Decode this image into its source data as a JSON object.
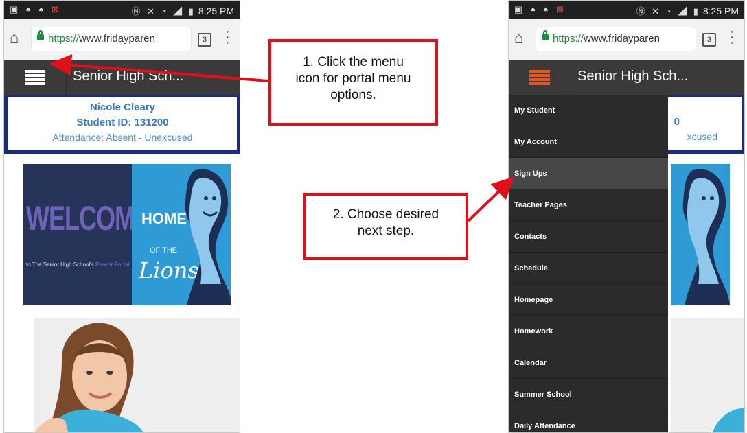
{
  "status_bar": {
    "time": "8:25 PM"
  },
  "browser": {
    "url_scheme": "https://",
    "url_rest": "www.fridayparen",
    "tab_count": "3"
  },
  "app": {
    "title_left": "Senior High Sch...",
    "title_right": "Senior High Sch..."
  },
  "student": {
    "name": "Nicole Cleary",
    "id_text": "Student ID: 131200",
    "attendance": "Attendance: Absent - Unexcused",
    "attendance_partial": "xcused",
    "id_partial": "0"
  },
  "banner": {
    "welcome": "WELCOME",
    "sub_text": "to The Senior High School's",
    "sub_highlight": "Parent Portal",
    "home": "HOME",
    "of_the": "OF THE",
    "lions": "Lions"
  },
  "menu": {
    "items": [
      {
        "label": "My Student"
      },
      {
        "label": "My Account"
      },
      {
        "label": "Sign Ups"
      },
      {
        "label": "Teacher Pages"
      },
      {
        "label": "Contacts"
      },
      {
        "label": "Schedule"
      },
      {
        "label": "Homepage"
      },
      {
        "label": "Homework"
      },
      {
        "label": "Calendar"
      },
      {
        "label": "Summer School"
      },
      {
        "label": "Daily Attendance"
      }
    ],
    "selected_index": 2
  },
  "callouts": {
    "step1": "1. Click the menu icon for portal menu options.",
    "step2": "2. Choose desired next step."
  },
  "colors": {
    "accent_menu": "#e8561e",
    "callout_border": "#e0101a",
    "panel_navy": "#1c2d72"
  }
}
